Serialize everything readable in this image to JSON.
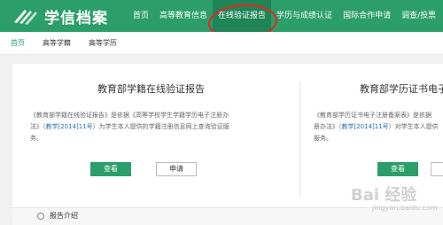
{
  "header": {
    "logo_text": "学信档案",
    "nav": [
      {
        "label": "首页"
      },
      {
        "label": "高等教育信息"
      },
      {
        "label": "在线验证报告"
      },
      {
        "label": "学历与成绩认证"
      },
      {
        "label": "国际合作申请"
      },
      {
        "label": "调查/投票"
      }
    ],
    "active_nav": "在线验证报告"
  },
  "subnav": {
    "items": [
      {
        "label": "首页"
      },
      {
        "label": "高等学籍"
      },
      {
        "label": "高等学历"
      }
    ]
  },
  "cards": [
    {
      "title": "教育部学籍在线验证报告",
      "desc_line1": "《教育部学籍在线验证报告》是依据《高等学校学生学籍学历电子注册办",
      "desc_line2_pre": "法》（",
      "desc_link": "教学[2014]11号",
      "desc_line2_post": "）为学生本人提供的学籍注册信息网上查询验证服",
      "desc_line3": "务。",
      "view_label": "查看",
      "apply_label": "申请"
    },
    {
      "title": "教育部学历证书电子",
      "desc_line1": "《教育部学历证书电子注册备案表》是依据",
      "desc_line2_pre": "册办法》（",
      "desc_link": "教学[2014]11号",
      "desc_line2_post": "）对学生本人提供",
      "desc_line3": "服务。",
      "view_label": "查看"
    }
  ],
  "section": {
    "intro_label": "报告介绍"
  },
  "watermark": {
    "main": "Bai 经验",
    "sub": "jingyan.baidu.com"
  },
  "colors": {
    "brand": "#2b9e6a",
    "link": "#2b6fb9",
    "highlight": "#e22222"
  }
}
